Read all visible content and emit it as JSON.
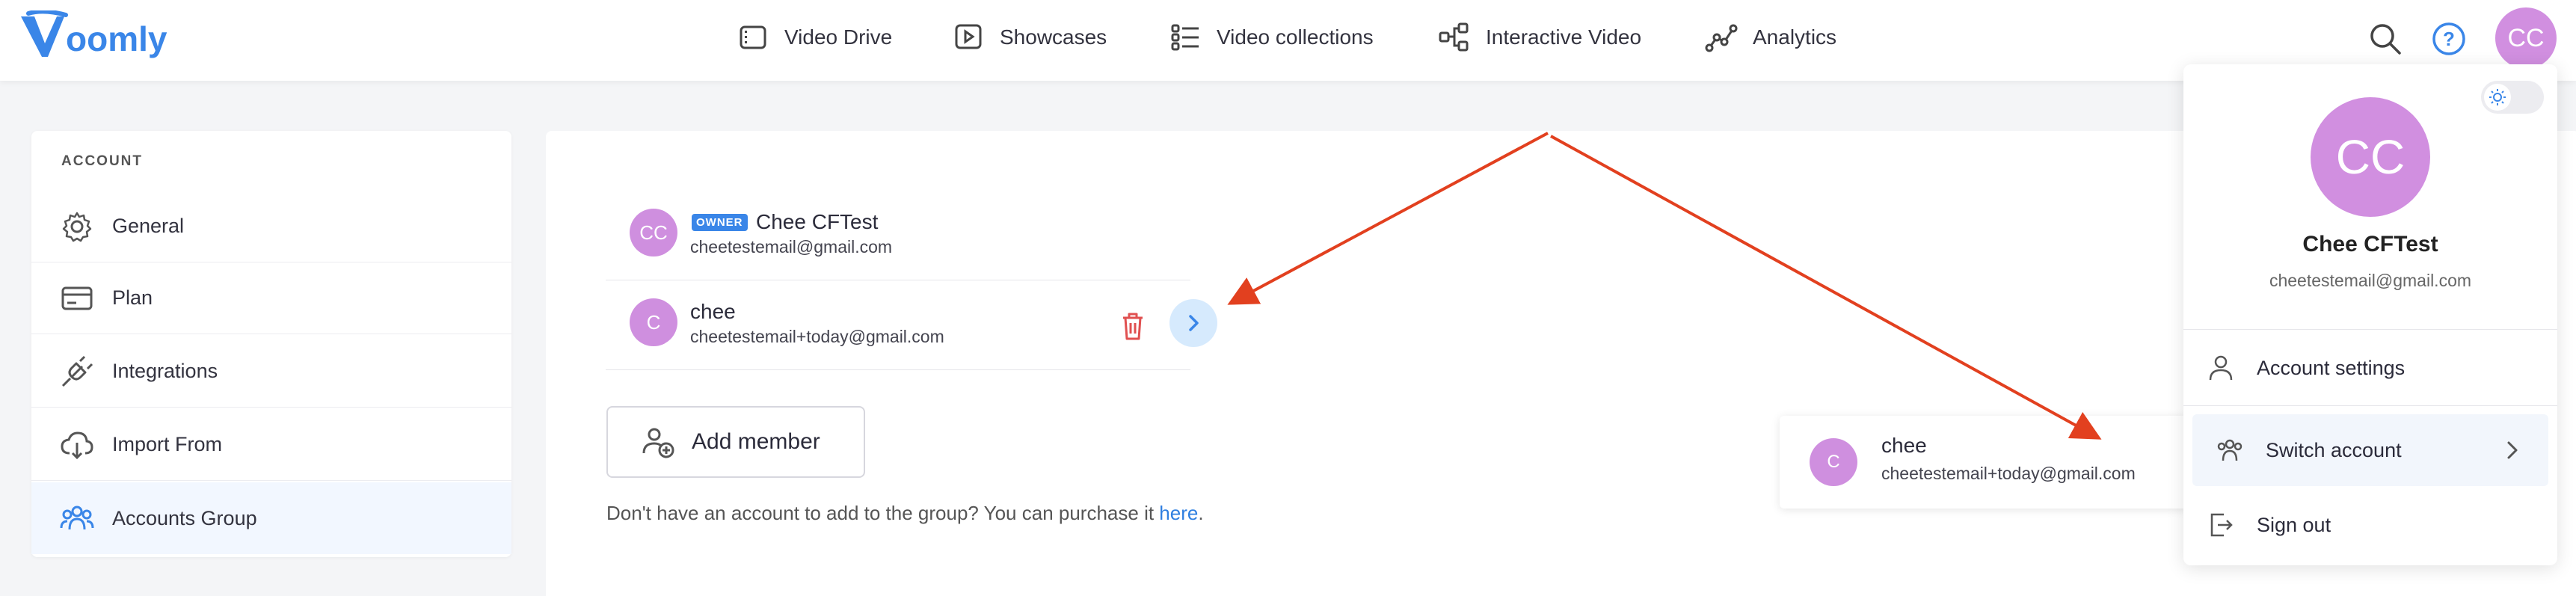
{
  "brand": {
    "name": "Voomly",
    "color": "#3a86e8"
  },
  "nav": {
    "items": [
      {
        "label": "Video Drive",
        "icon": "video-drive-icon"
      },
      {
        "label": "Showcases",
        "icon": "showcases-icon"
      },
      {
        "label": "Video collections",
        "icon": "collections-icon"
      },
      {
        "label": "Interactive Video",
        "icon": "interactive-icon"
      },
      {
        "label": "Analytics",
        "icon": "analytics-icon"
      }
    ],
    "avatar_initials": "CC"
  },
  "sidebar": {
    "section_label": "ACCOUNT",
    "items": [
      {
        "label": "General",
        "icon": "gear-icon"
      },
      {
        "label": "Plan",
        "icon": "card-icon"
      },
      {
        "label": "Integrations",
        "icon": "plug-icon"
      },
      {
        "label": "Import From",
        "icon": "cloud-download-icon"
      },
      {
        "label": "Accounts Group",
        "icon": "users-icon",
        "active": true
      }
    ]
  },
  "members": [
    {
      "initials": "CC",
      "badge": "OWNER",
      "name": "Chee CFTest",
      "email": "cheetestemail@gmail.com"
    },
    {
      "initials": "C",
      "name": "chee",
      "email": "cheetestemail+today@gmail.com"
    }
  ],
  "add_member_label": "Add member",
  "help": {
    "text": "Don't have an account to add to the group? You can purchase it ",
    "link": "here",
    "suffix": "."
  },
  "switch_submenu": {
    "initials": "C",
    "name": "chee",
    "email": "cheetestemail+today@gmail.com"
  },
  "dropdown": {
    "initials": "CC",
    "name": "Chee CFTest",
    "email": "cheetestemail@gmail.com",
    "items": [
      {
        "label": "Account settings",
        "icon": "user-icon"
      },
      {
        "label": "Switch account",
        "icon": "users-icon"
      },
      {
        "label": "Sign out",
        "icon": "sign-out-icon"
      }
    ]
  },
  "colors": {
    "avatar": "#d18fe0",
    "annotation_arrow": "#e2401f",
    "link": "#2f7fe0",
    "danger": "#e05050"
  }
}
